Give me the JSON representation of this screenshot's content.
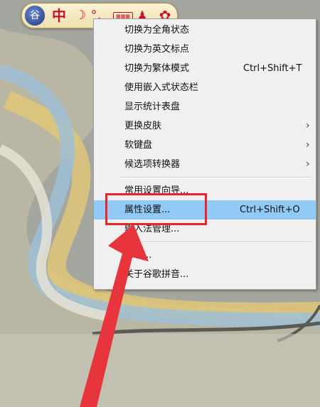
{
  "ime_toolbar": {
    "logo_glyph": "谷",
    "mode_label": "中",
    "width_icon": "moon-icon",
    "width_glyph": "☽",
    "punct_icon": "punctuation-icon",
    "punct_glyph": "°,",
    "keyboard_icon": "keyboard-icon",
    "keyboard_glyph": "▦▦▦",
    "skin_icon": "person-icon",
    "skin_glyph": "♟",
    "tools_icon": "gear-icon",
    "tools_glyph": "✿"
  },
  "context_menu": {
    "items": [
      {
        "label": "切换为全角状态",
        "shortcut": "",
        "submenu": false
      },
      {
        "label": "切换为英文标点",
        "shortcut": "",
        "submenu": false
      },
      {
        "label": "切换为繁体模式",
        "shortcut": "Ctrl+Shift+T",
        "submenu": false
      },
      {
        "label": "使用嵌入式状态栏",
        "shortcut": "",
        "submenu": false
      },
      {
        "label": "显示统计表盘",
        "shortcut": "",
        "submenu": false
      },
      {
        "label": "更换皮肤",
        "shortcut": "",
        "submenu": true
      },
      {
        "label": "软键盘",
        "shortcut": "",
        "submenu": true
      },
      {
        "label": "候选项转换器",
        "shortcut": "",
        "submenu": true
      },
      {
        "label": "常用设置向导...",
        "shortcut": "",
        "submenu": false
      },
      {
        "label": "属性设置...",
        "shortcut": "Ctrl+Shift+O",
        "submenu": false,
        "highlighted": true
      },
      {
        "label": "输入法管理...",
        "shortcut": "",
        "submenu": false
      },
      {
        "label": "帮助...",
        "shortcut": "",
        "submenu": false
      },
      {
        "label": "关于谷歌拼音...",
        "shortcut": "",
        "submenu": false
      }
    ],
    "submenu_arrow": "›"
  },
  "annotation": {
    "highlight_color": "#e8242c",
    "arrow_color": "#e8343c",
    "menu_highlight_color": "#91c9f7"
  }
}
